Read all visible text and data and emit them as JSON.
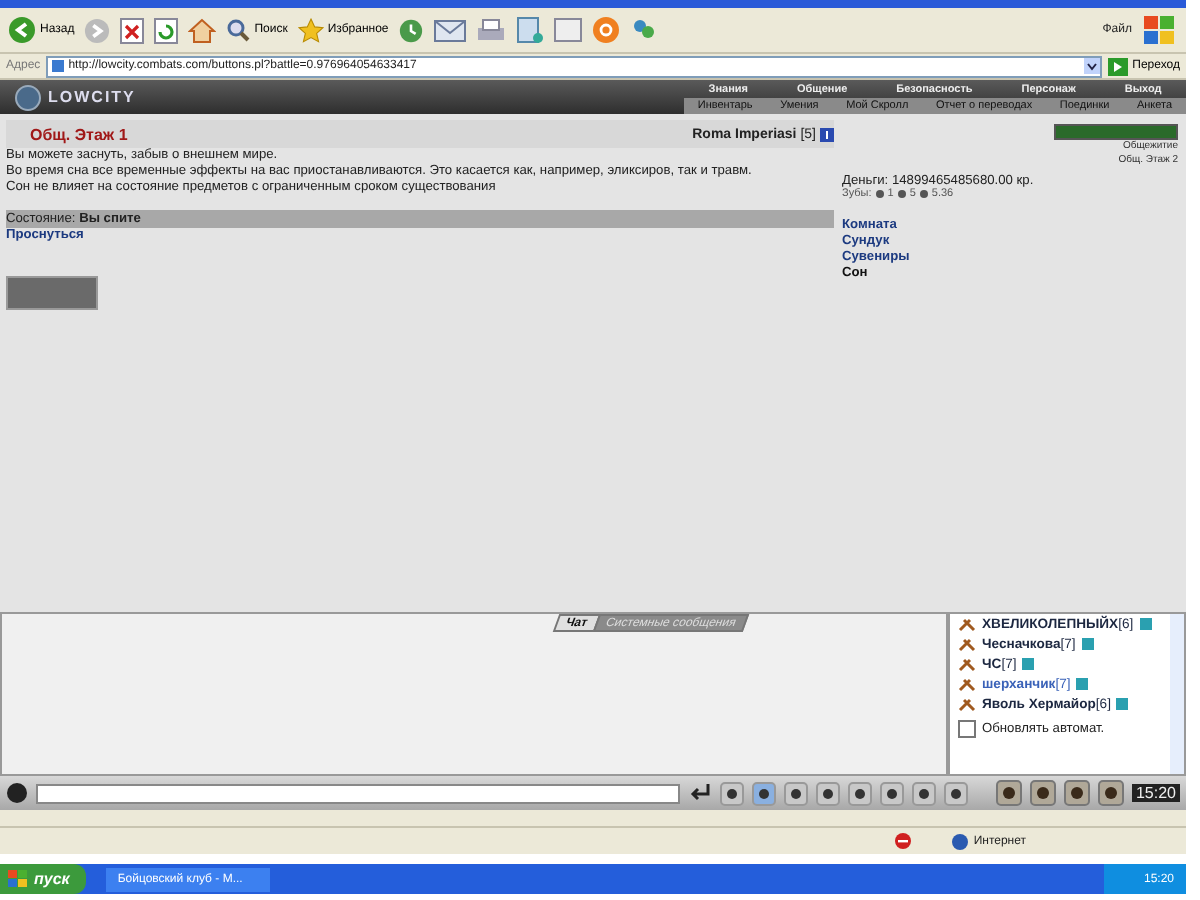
{
  "browser": {
    "buttons": [
      {
        "kind": "back",
        "label": "Назад"
      },
      {
        "kind": "search",
        "label": "Поиск"
      },
      {
        "kind": "favorites",
        "label": "Избранное"
      }
    ],
    "menu_label": "Файл",
    "address_label": "Адрес",
    "address": "http://lowcity.combats.com/buttons.pl?battle=0.976964054633417",
    "go_button": "Переход"
  },
  "game": {
    "logo": "LOWCITY",
    "menu": [
      "Знания",
      "Общение",
      "Безопасность",
      "Персонаж",
      "Выход"
    ],
    "submenu": [
      "Инвентарь",
      "Умения",
      "Мой Скролл",
      "Отчет о переводах",
      "Поединки",
      "Анкета"
    ]
  },
  "room": {
    "title": "Общ. Этаж 1",
    "player": "Roma Imperiasi",
    "player_rank": "[5]",
    "paragraphs": [
      "Вы можете заснуть, забыв о внешнем мире.",
      "Во время сна все временные эффекты на вас приостанавливаются. Это касается как, например, эликсиров, так и травм.",
      "Сон не влияет на состояние предметов с ограниченным сроком существования"
    ],
    "status_label": "Состояние:",
    "status_value": "Вы спите",
    "wake_link": "Проснуться",
    "money": "Деньги: 14899465485680.00 кр.",
    "teeth_label": "Зубы:",
    "teeth": [
      "1",
      "5",
      "5.36"
    ],
    "links": [
      {
        "label": "Комната",
        "selected": false
      },
      {
        "label": "Сундук",
        "selected": false
      },
      {
        "label": "Сувениры",
        "selected": false
      },
      {
        "label": "Сон",
        "selected": true
      }
    ]
  },
  "mini_panel": {
    "level": 1,
    "locations": [
      "Общежитие",
      "Общ. Этаж 2"
    ]
  },
  "chat": {
    "tabs": [
      {
        "label": "Чат",
        "selected": true
      },
      {
        "label": "Системные сообщения",
        "selected": false
      }
    ]
  },
  "online": {
    "users": [
      {
        "name": "ХВЕЛИКОЛЕПНЫЙХ",
        "rank": "[6]",
        "color": "#1c2740"
      },
      {
        "name": "Чесначкова",
        "rank": "[7]",
        "color": "#1c2740"
      },
      {
        "name": "ЧС",
        "rank": "[7]",
        "color": "#1c2740"
      },
      {
        "name": "шерханчик",
        "rank": "[7]",
        "color": "#3a62b8"
      },
      {
        "name": "Яволь Хермайор",
        "rank": "[6]",
        "color": "#1c2740"
      }
    ],
    "auto_refresh": {
      "label": "Обновлять автомат.",
      "checked": false
    }
  },
  "clock": "15:20",
  "status_bar": {
    "zone": "Интернет"
  },
  "taskbar": {
    "start": "пуск",
    "task": "Бойцовский клуб - М...",
    "time": "15:20"
  }
}
